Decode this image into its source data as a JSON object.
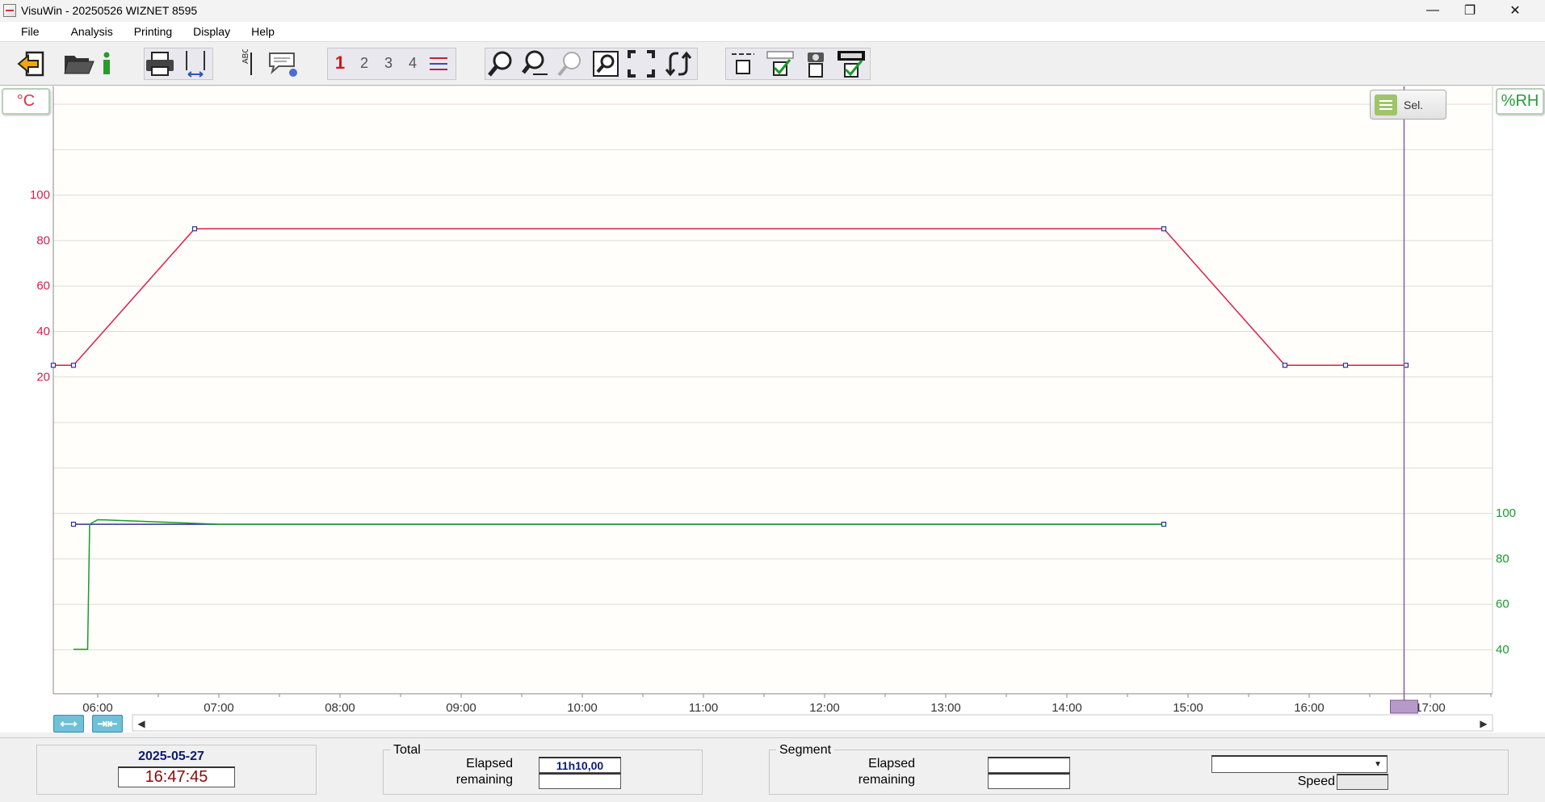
{
  "window": {
    "title": "VisuWin - 20250526 WIZNET 8595",
    "minimize_glyph": "—",
    "maximize_glyph": "❐",
    "close_glyph": "✕"
  },
  "menu": [
    "File",
    "Analysis",
    "Printing",
    "Display",
    "Help"
  ],
  "toolbar": {
    "channels": [
      "1",
      "2",
      "3",
      "4"
    ],
    "icons": [
      "exit-icon",
      "open-folder-icon",
      "info-icon",
      "print-icon",
      "cursor-icon",
      "text-label-icon",
      "comment-icon",
      "channel-list-icon",
      "zoom-icon",
      "zoom-horizontal-icon",
      "zoom-previous-icon",
      "zoom-window-icon",
      "fit-all-icon",
      "refresh-icon",
      "checkbox-options-icon",
      "camera-icon",
      "display-check-icon"
    ]
  },
  "chart": {
    "left_unit": "°C",
    "right_unit": "%RH",
    "select_label": "Sel.",
    "left_ticks": [
      "100",
      "80",
      "60",
      "40",
      "20"
    ],
    "right_ticks": [
      "100",
      "80",
      "60",
      "40"
    ],
    "x_ticks": [
      "06:00",
      "07:00",
      "08:00",
      "09:00",
      "10:00",
      "11:00",
      "12:00",
      "13:00",
      "14:00",
      "15:00",
      "16:00",
      "17:00"
    ],
    "colors": {
      "temperature": "#d8204a",
      "humidity": "#1a9a2a",
      "setpoint": "#303090",
      "cursor": "#8a5aa8"
    }
  },
  "chart_data": {
    "type": "line",
    "series": [
      {
        "x": [
          "05:38",
          "05:48",
          "06:48",
          "14:48",
          "15:48",
          "16:18",
          "16:48"
        ],
        "values": [
          25,
          25,
          85,
          85,
          25,
          25,
          25
        ]
      },
      {
        "x": [
          "05:48",
          "05:55",
          "05:56",
          "06:00",
          "06:30",
          "07:00",
          "14:48"
        ],
        "values": [
          40,
          40,
          95,
          97,
          96,
          95,
          95
        ]
      }
    ],
    "y_left_ticks": [
      20,
      40,
      60,
      80,
      100
    ],
    "y_right_ticks": [
      40,
      60,
      80,
      100
    ],
    "cursor_time": "16:47:45"
  },
  "status": {
    "date": "2025-05-27",
    "time": "16:47:45",
    "total_label": "Total",
    "segment_label": "Segment",
    "elapsed_label": "Elapsed",
    "remaining_label": "remaining",
    "total_elapsed": "11h10,00",
    "total_remaining": "",
    "segment_elapsed": "",
    "segment_remaining": "",
    "speed_label": "Speed",
    "speed_value": "",
    "dropdown_value": ""
  }
}
